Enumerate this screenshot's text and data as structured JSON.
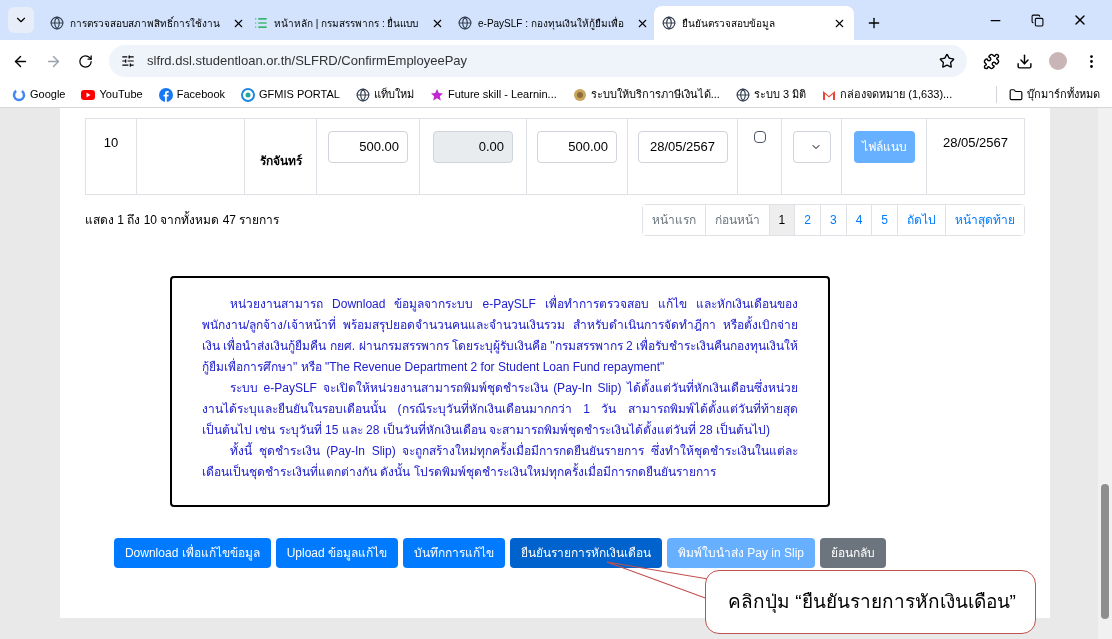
{
  "browser": {
    "tabs": [
      {
        "title": "การตรวจสอบสภาพสิทธิ์การใช้งาน",
        "selected": false
      },
      {
        "title": "หน้าหลัก | กรมสรรพากร : ยื่นแบบ",
        "selected": false
      },
      {
        "title": "e-PaySLF : กองทุนเงินให้กู้ยืมเพื่อ",
        "selected": false
      },
      {
        "title": "ยืนยันตรวจสอบข้อมูล",
        "selected": true
      }
    ],
    "url": "slfrd.dsl.studentloan.or.th/SLFRD/ConfirmEmployeePay",
    "bookmarks": [
      "Google",
      "YouTube",
      "Facebook",
      "GFMIS PORTAL",
      "แท็บใหม่",
      "Future skill - Learnin...",
      "ระบบให้บริการภาษีเงินได้...",
      "ระบบ 3 มิติ",
      "กล่องจดหมาย (1,633)..."
    ],
    "all_bookmarks": "บุ๊กมาร์กทั้งหมด"
  },
  "table": {
    "rows": [
      {
        "no": "10",
        "surname": "รักจันทร์",
        "amount": "500.00",
        "deduction": "0.00",
        "total": "500.00",
        "date_input": "28/05/2567",
        "checked": false,
        "attach": "ไฟล์แนบ",
        "date": "28/05/2567"
      }
    ]
  },
  "summary": "แสดง 1 ถึง 10 จากทั้งหมด 47 รายการ",
  "pagination": [
    {
      "label": "หน้าแรก",
      "selected": false,
      "disabled": true
    },
    {
      "label": "ก่อนหน้า",
      "selected": false,
      "disabled": true
    },
    {
      "label": "1",
      "selected": true,
      "disabled": false
    },
    {
      "label": "2",
      "selected": false,
      "disabled": false
    },
    {
      "label": "3",
      "selected": false,
      "disabled": false
    },
    {
      "label": "4",
      "selected": false,
      "disabled": false
    },
    {
      "label": "5",
      "selected": false,
      "disabled": false
    },
    {
      "label": "ถัดไป",
      "selected": false,
      "disabled": false
    },
    {
      "label": "หน้าสุดท้าย",
      "selected": false,
      "disabled": false
    }
  ],
  "notice": [
    "หน่วยงานสามารถ Download ข้อมูลจากระบบ e-PaySLF เพื่อทำการตรวจสอบ แก้ไข และหักเงินเดือนของพนักงาน/ลูกจ้าง/เจ้าหน้าที่ พร้อมสรุปยอดจำนวนคนและจำนวนเงินรวม สำหรับดำเนินการจัดทำฎีกา หรือตั้งเบิกจ่ายเงิน เพื่อนำส่งเงินกู้ยืมคืน กยศ. ผ่านกรมสรรพากร โดยระบุผู้รับเงินคือ \"กรมสรรพากร 2 เพื่อรับชำระเงินคืนกองทุนเงินให้กู้ยืมเพื่อการศึกษา\" หรือ \"The Revenue Department 2 for Student Loan Fund repayment\"",
    "ระบบ e-PaySLF จะเปิดให้หน่วยงานสามารถพิมพ์ชุดชำระเงิน (Pay-In Slip) ได้ตั้งแต่วันที่หักเงินเดือนซึ่งหน่วยงานได้ระบุและยืนยันในรอบเดือนนั้น (กรณีระบุวันที่หักเงินเดือนมากกว่า 1 วัน สามารถพิมพ์ได้ตั้งแต่วันที่ท้ายสุดเป็นต้นไป เช่น ระบุวันที่ 15 และ 28 เป็นวันที่หักเงินเดือน จะสามารถพิมพ์ชุดชำระเงินได้ตั้งแต่วันที่ 28 เป็นต้นไป)",
    "ทั้งนี้ ชุดชำระเงิน (Pay-In Slip) จะถูกสร้างใหม่ทุกครั้งเมื่อมีการกดยืนยันรายการ ซึ่งทำให้ชุดชำระเงินในแต่ละเดือนเป็นชุดชำระเงินที่แตกต่างกัน ดังนั้น โปรดพิมพ์ชุดชำระเงินใหม่ทุกครั้งเมื่อมีการกดยืนยันรายการ"
  ],
  "actions": [
    {
      "label": "Download เพื่อแก้ไขข้อมูล",
      "kind": "primary"
    },
    {
      "label": "Upload ข้อมูลแก้ไข",
      "kind": "primary"
    },
    {
      "label": "บันทึกการแก้ไข",
      "kind": "primary"
    },
    {
      "label": "ยืนยันรายการหักเงินเดือน",
      "kind": "active"
    },
    {
      "label": "พิมพ์ใบนำส่ง Pay in Slip",
      "kind": "disabled"
    },
    {
      "label": "ย้อนกลับ",
      "kind": "secondary"
    }
  ],
  "callout": "คลิกปุ่ม “ยืนยันรายการหักเงินเดือน”"
}
